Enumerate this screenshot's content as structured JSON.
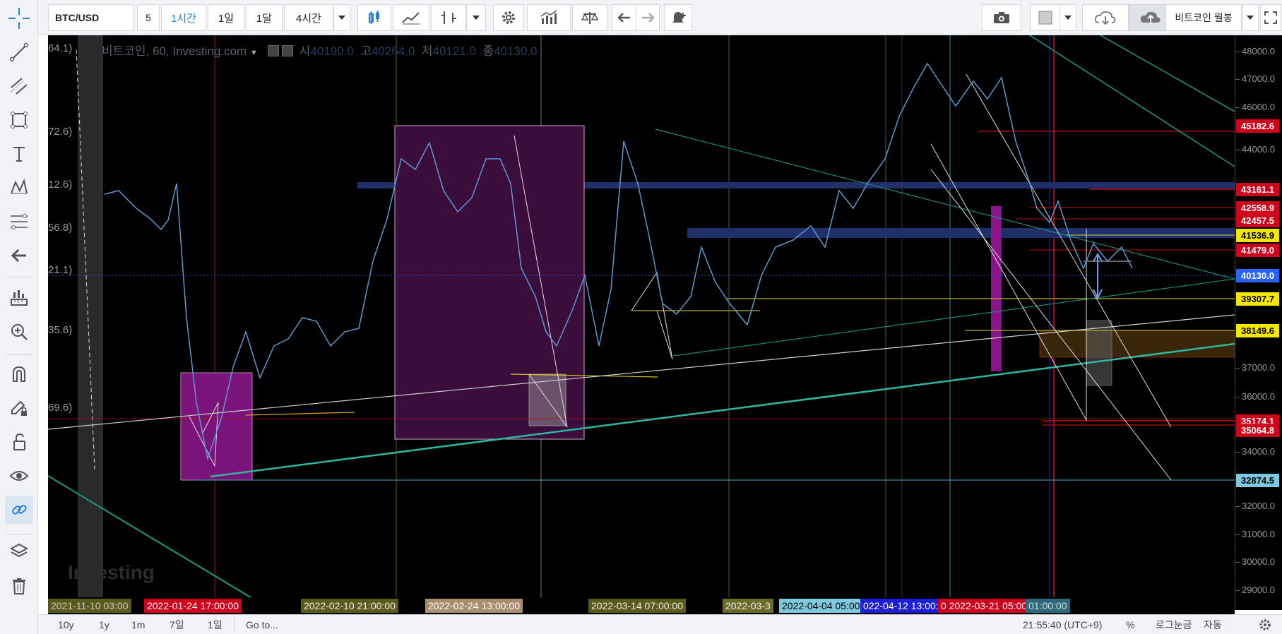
{
  "toolbar": {
    "symbol": "BTC/USD",
    "interval_input": "5",
    "intervals": [
      "1시간",
      "1일",
      "1달",
      "4시간"
    ],
    "active_interval": "1시간",
    "layout_select": "비트코인 월봉"
  },
  "legend": {
    "title": "비트코인, 60, Investing.com",
    "open_label": "시",
    "open": "40190.0",
    "high_label": "고",
    "high": "40264.0",
    "low_label": "저",
    "low": "40121.0",
    "close_label": "종",
    "close": "40130.0"
  },
  "left_scale_labels": [
    "64.1)",
    "72.6)",
    "12.6)",
    "56.8)",
    "21.1)",
    "35.6)",
    "69.6)"
  ],
  "watermark": "Investing",
  "price_axis": {
    "ticks": [
      "48000.0",
      "47000.0",
      "46000.0",
      "44000.0",
      "37000.0",
      "36000.0",
      "34000.0",
      "33000.0",
      "32000.0",
      "31000.0",
      "30000.0",
      "29000.0"
    ],
    "labels": [
      {
        "text": "45182.6",
        "bg": "#d0021b",
        "fg": "#ffffff"
      },
      {
        "text": "43161.1",
        "bg": "#d0021b",
        "fg": "#ffffff"
      },
      {
        "text": "42558.9",
        "bg": "#d0021b",
        "fg": "#ffffff"
      },
      {
        "text": "42457.5",
        "bg": "#d0021b",
        "fg": "#ffffff"
      },
      {
        "text": "41536.9",
        "bg": "#f3e600",
        "fg": "#000000"
      },
      {
        "text": "41479.0",
        "bg": "#d0021b",
        "fg": "#ffffff"
      },
      {
        "text": "40130.0",
        "bg": "#2962ff",
        "fg": "#ffffff"
      },
      {
        "text": "39307.7",
        "bg": "#f3e600",
        "fg": "#000000"
      },
      {
        "text": "38149.6",
        "bg": "#f3e600",
        "fg": "#000000"
      },
      {
        "text": "35174.1",
        "bg": "#d0021b",
        "fg": "#ffffff"
      },
      {
        "text": "35064.8",
        "bg": "#d0021b",
        "fg": "#ffffff"
      },
      {
        "text": "32874.5",
        "bg": "#7fc9e0",
        "fg": "#000000"
      }
    ]
  },
  "time_axis": [
    {
      "text": "2021-11-10 03:00",
      "bg": "#5a5a1a",
      "fg": "#cccccc"
    },
    {
      "text": "2022-01-24 17:00:00",
      "bg": "#d0021b",
      "fg": "#ffffff"
    },
    {
      "text": "2022-02-10 21:00:00",
      "bg": "#5a5a1a",
      "fg": "#eeeeee"
    },
    {
      "text": "2022-02-24 13:00:00",
      "bg": "#a98e6e",
      "fg": "#ffffff"
    },
    {
      "text": "2022-03-14 07:00:00",
      "bg": "#5a5a1a",
      "fg": "#eeeeee"
    },
    {
      "text": "2022-03-3",
      "bg": "#6b6b2a",
      "fg": "#eeeeee"
    },
    {
      "text": "2022-04-04 05:00:00",
      "bg": "#7fc9e0",
      "fg": "#000000"
    },
    {
      "text": "022-04-12 13:00:00",
      "bg": "#1e1ed6",
      "fg": "#ffffff"
    },
    {
      "text": "0 2022-03-21 05:00:00",
      "bg": "#d0021b",
      "fg": "#ffffff"
    },
    {
      "text": "01:00:00",
      "bg": "#2a6a7a",
      "fg": "#dddddd"
    }
  ],
  "bottom": {
    "ranges": [
      "10y",
      "1y",
      "1m",
      "7일",
      "1일"
    ],
    "goto": "Go to...",
    "clock": "21:55:40 (UTC+9)",
    "percent": "%",
    "log": "로그눈금",
    "auto": "자동"
  }
}
